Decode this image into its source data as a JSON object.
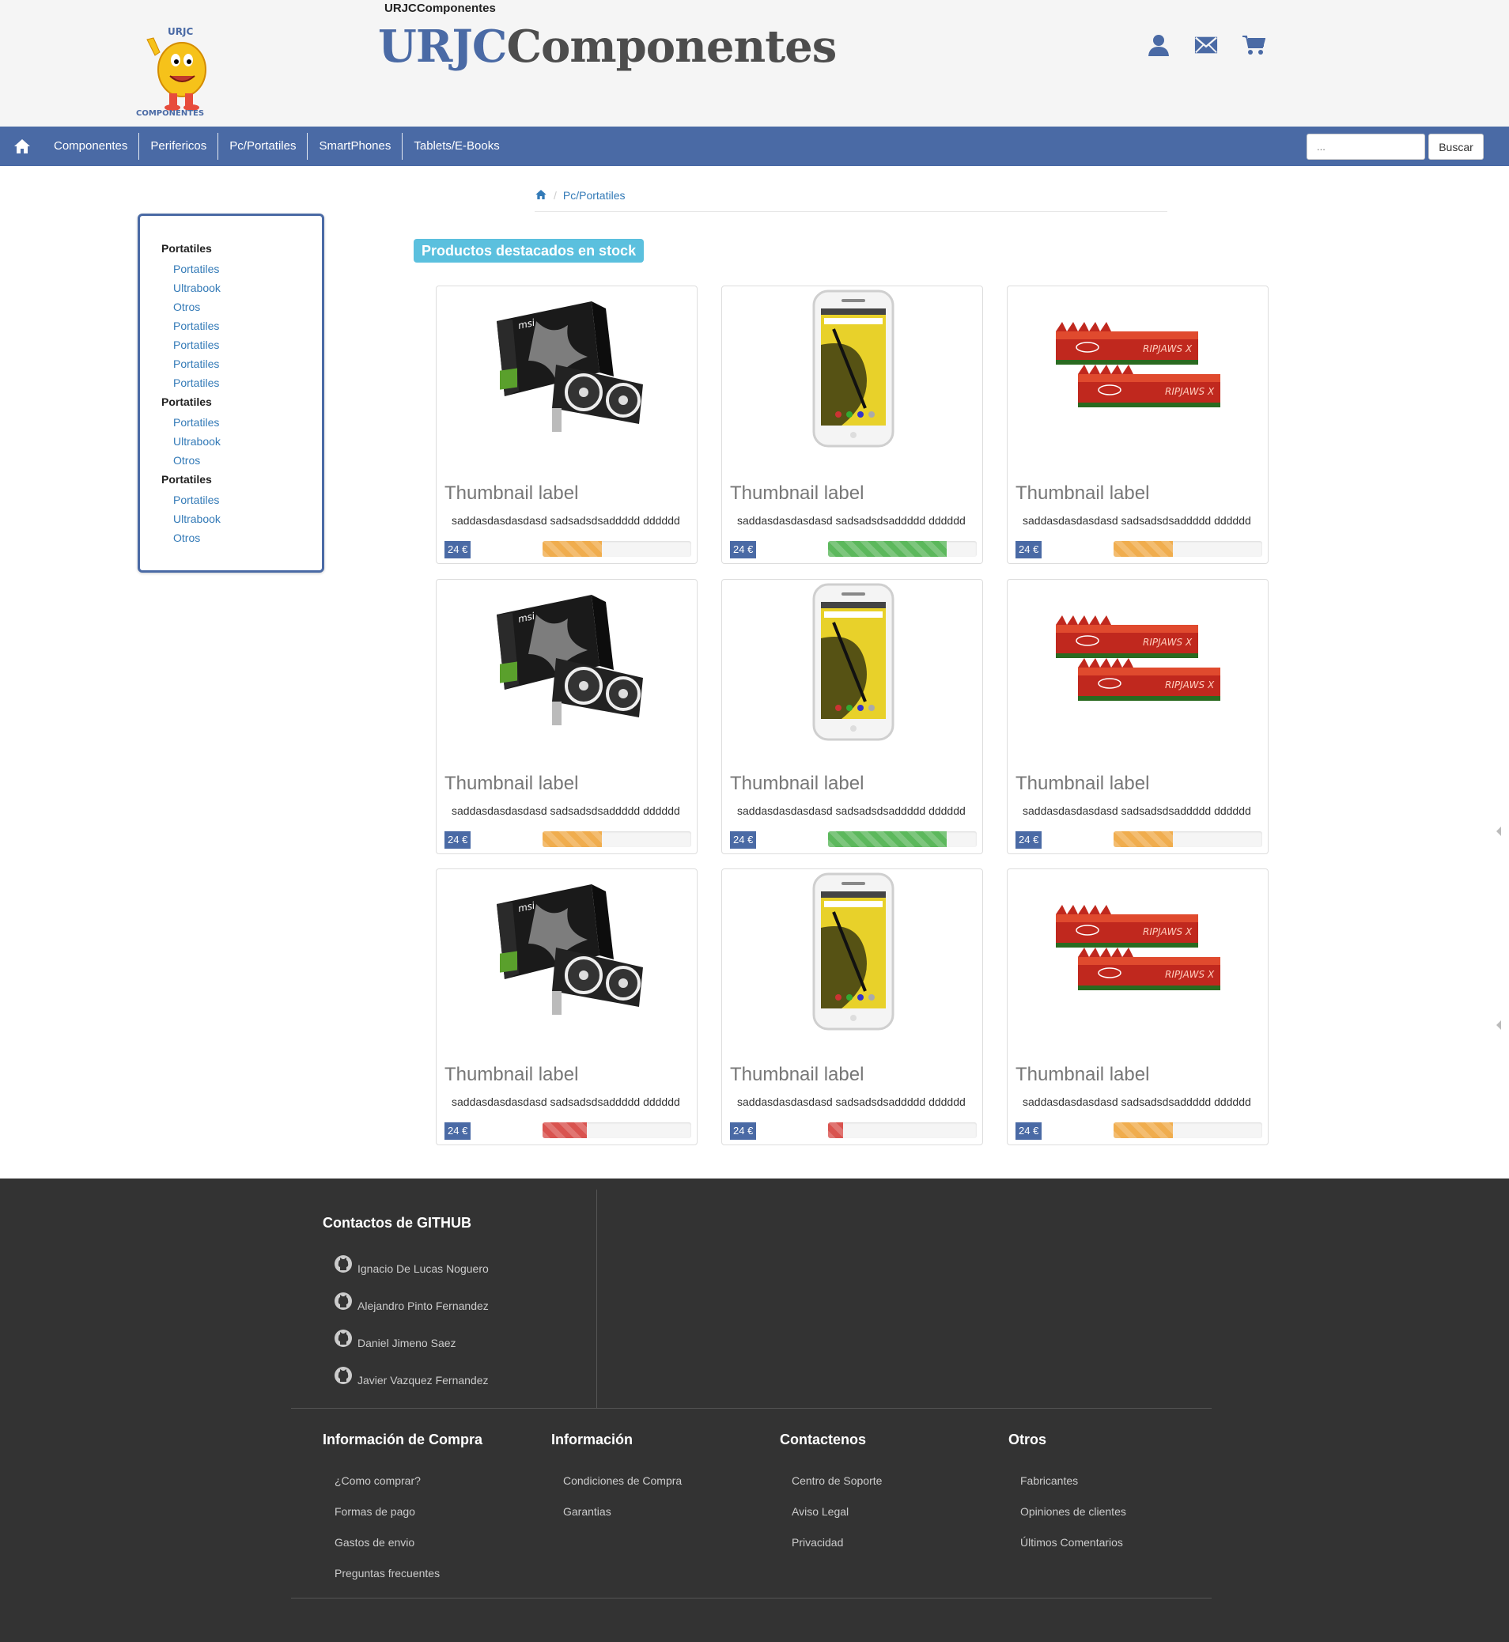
{
  "header": {
    "small_title": "URJCComponentes",
    "brand_part_1": "URJC",
    "brand_part_2": "Componentes",
    "logo_text_top": "URJC",
    "logo_text_bottom": "COMPONENTES",
    "icons": [
      "user-icon",
      "envelope-icon",
      "cart-icon"
    ]
  },
  "nav": {
    "items": [
      "Componentes",
      "Perifericos",
      "Pc/Portatiles",
      "SmartPhones",
      "Tablets/E-Books"
    ],
    "search_placeholder": "...",
    "search_button": "Buscar"
  },
  "breadcrumb": {
    "current": "Pc/Portatiles"
  },
  "sidebar": {
    "groups": [
      {
        "title": "Portatiles",
        "links": [
          "Portatiles",
          "Ultrabook",
          "Otros",
          "Portatiles",
          "Portatiles",
          "Portatiles",
          "Portatiles"
        ]
      },
      {
        "title": "Portatiles",
        "links": [
          "Portatiles",
          "Ultrabook",
          "Otros"
        ]
      },
      {
        "title": "Portatiles",
        "links": [
          "Portatiles",
          "Ultrabook",
          "Otros"
        ]
      }
    ]
  },
  "featured": {
    "label": "Productos destacados en stock"
  },
  "products": [
    {
      "image": "graphics-card",
      "label": "Thumbnail label",
      "description": "saddasdasdasdasd sadsadsdsaddddd dddddd",
      "price": "24 €",
      "stock_percent": 40,
      "stock_color": "#f0ad4e"
    },
    {
      "image": "smartphone",
      "label": "Thumbnail label",
      "description": "saddasdasdasdasd sadsadsdsaddddd dddddd",
      "price": "24 €",
      "stock_percent": 80,
      "stock_color": "#5cb85c"
    },
    {
      "image": "ram-modules",
      "label": "Thumbnail label",
      "description": "saddasdasdasdasd sadsadsdsaddddd dddddd",
      "price": "24 €",
      "stock_percent": 40,
      "stock_color": "#f0ad4e"
    },
    {
      "image": "graphics-card",
      "label": "Thumbnail label",
      "description": "saddasdasdasdasd sadsadsdsaddddd dddddd",
      "price": "24 €",
      "stock_percent": 40,
      "stock_color": "#f0ad4e"
    },
    {
      "image": "smartphone",
      "label": "Thumbnail label",
      "description": "saddasdasdasdasd sadsadsdsaddddd dddddd",
      "price": "24 €",
      "stock_percent": 80,
      "stock_color": "#5cb85c"
    },
    {
      "image": "ram-modules",
      "label": "Thumbnail label",
      "description": "saddasdasdasdasd sadsadsdsaddddd dddddd",
      "price": "24 €",
      "stock_percent": 40,
      "stock_color": "#f0ad4e"
    },
    {
      "image": "graphics-card",
      "label": "Thumbnail label",
      "description": "saddasdasdasdasd sadsadsdsaddddd dddddd",
      "price": "24 €",
      "stock_percent": 30,
      "stock_color": "#d9534f"
    },
    {
      "image": "smartphone",
      "label": "Thumbnail label",
      "description": "saddasdasdasdasd sadsadsdsaddddd dddddd",
      "price": "24 €",
      "stock_percent": 10,
      "stock_color": "#d9534f"
    },
    {
      "image": "ram-modules",
      "label": "Thumbnail label",
      "description": "saddasdasdasdasd sadsadsdsaddddd dddddd",
      "price": "24 €",
      "stock_percent": 40,
      "stock_color": "#f0ad4e"
    }
  ],
  "footer": {
    "github_title": "Contactos de GITHUB",
    "github_contacts": [
      "Ignacio De Lucas Noguero",
      "Alejandro Pinto Fernandez",
      "Daniel Jimeno Saez",
      "Javier Vazquez Fernandez"
    ],
    "columns": [
      {
        "title": "Información de Compra",
        "links": [
          "¿Como comprar?",
          "Formas de pago",
          "Gastos de envio",
          "Preguntas frecuentes"
        ]
      },
      {
        "title": "Información",
        "links": [
          "Condiciones de Compra",
          "Garantias"
        ]
      },
      {
        "title": "Contactenos",
        "links": [
          "Centro de Soporte",
          "Aviso Legal",
          "Privacidad"
        ]
      },
      {
        "title": "Otros",
        "links": [
          "Fabricantes",
          "Opiniones de clientes",
          "Últimos Comentarios"
        ]
      }
    ]
  },
  "colors": {
    "primary": "#4a6aa5",
    "featured": "#5bc0de",
    "footer_bg": "#333333"
  }
}
